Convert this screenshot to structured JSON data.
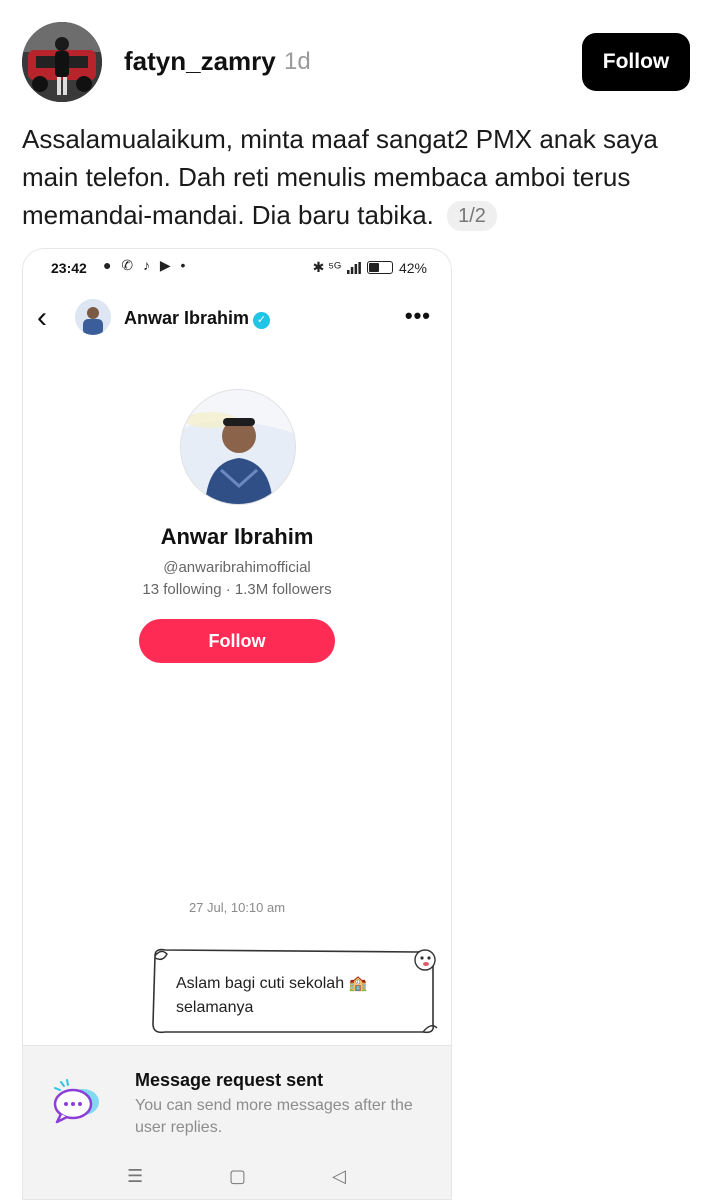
{
  "post": {
    "username": "fatyn_zamry",
    "time_ago": "1d",
    "follow_label": "Follow",
    "caption": "Assalamualaikum, minta maaf sangat2 PMX anak saya main telefon. Dah reti menulis membaca amboi terus memandai-mandai. Dia baru tabika.",
    "page_indicator": "1/2"
  },
  "screenshot": {
    "status_bar": {
      "time": "23:42",
      "left_icons": "● ✆ ♪ ▶ •",
      "right_icons": "✱ ⁵ᴳ",
      "battery": "42%"
    },
    "top_bar": {
      "name": "Anwar Ibrahim",
      "verified_mark": "✓",
      "back_icon": "‹",
      "more_icon": "•••"
    },
    "profile": {
      "name": "Anwar Ibrahim",
      "handle": "@anwaribrahimofficial",
      "stats": "13 following · 1.3M followers",
      "follow_label": "Follow"
    },
    "message": {
      "timestamp": "27 Jul, 10:10 am",
      "text": "Aslam bagi cuti sekolah",
      "text2": "selamanya",
      "emoji": "🏫"
    },
    "request": {
      "title": "Message request sent",
      "subtitle": "You can send more messages after the user replies."
    },
    "nav": {
      "menu_icon": "☰",
      "home_icon": "▢",
      "back_icon": "◁"
    }
  },
  "colors": {
    "follow_black": "#000000",
    "tiktok_pink": "#fe2c55",
    "verified_cyan": "#20c4e4"
  }
}
